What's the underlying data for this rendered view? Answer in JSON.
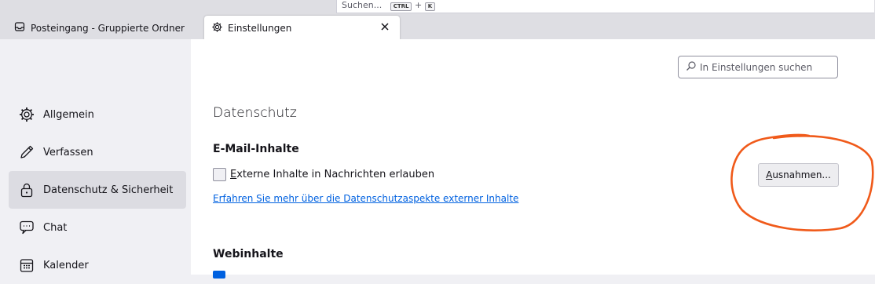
{
  "top_search": {
    "placeholder": "Suchen...",
    "key1": "CTRL",
    "plus": "+",
    "key2": "K"
  },
  "tabs": [
    {
      "label": "Posteingang - Gruppierte Ordner",
      "icon": "inbox-icon"
    },
    {
      "label": "Einstellungen",
      "icon": "gear-icon",
      "close_icon": "close-icon"
    }
  ],
  "sidebar": {
    "items": [
      {
        "label": "Allgemein",
        "icon": "gear-icon"
      },
      {
        "label": "Verfassen",
        "icon": "pencil-icon"
      },
      {
        "label": "Datenschutz & Sicherheit",
        "icon": "lock-icon",
        "selected": true
      },
      {
        "label": "Chat",
        "icon": "chat-icon"
      },
      {
        "label": "Kalender",
        "icon": "calendar-icon"
      }
    ]
  },
  "settings_search": {
    "placeholder": "In Einstellungen suchen"
  },
  "main": {
    "title": "Datenschutz",
    "email_section": {
      "heading": "E-Mail-Inhalte",
      "checkbox_prefix": "E",
      "checkbox_rest": "xterne Inhalte in Nachrichten erlauben",
      "checkbox_checked": false,
      "link": "Erfahren Sie mehr über die Datenschutzaspekte externer Inhalte",
      "exceptions_prefix": "A",
      "exceptions_rest": "usnahmen..."
    },
    "web_section": {
      "heading": "Webinhalte"
    }
  },
  "colors": {
    "accent": "#0061e0",
    "annotation": "#f05a1a",
    "selected_bg": "#dcdce2"
  }
}
